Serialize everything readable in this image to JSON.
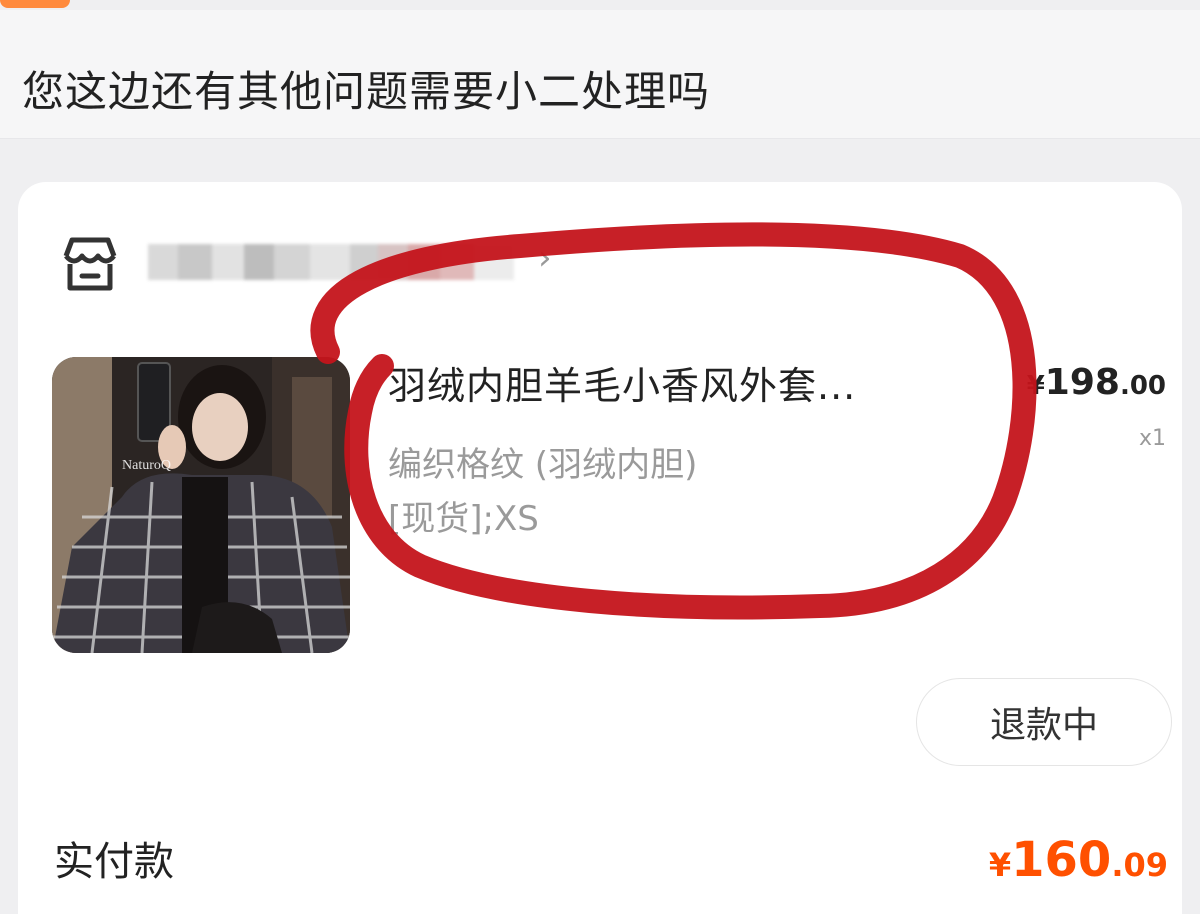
{
  "chat": {
    "message": "您这边还有其他问题需要小二处理吗"
  },
  "order": {
    "product": {
      "title": "羽绒内胆羊毛小香风外套...",
      "spec_line1": "编织格纹 (羽绒内胆)",
      "spec_line2": "[现货];XS",
      "thumbnail_watermark": "NaturoQ"
    },
    "price": {
      "currency": "¥",
      "integer": "198",
      "decimal": ".00"
    },
    "quantity": "x1",
    "refund_button_label": "退款中",
    "paid": {
      "label": "实付款",
      "currency": "¥",
      "integer": "160",
      "decimal": ".09"
    }
  },
  "colors": {
    "accent_orange": "#ff5000",
    "annotation_red": "#c4141b"
  },
  "icons": {
    "shop": "shop-icon"
  }
}
